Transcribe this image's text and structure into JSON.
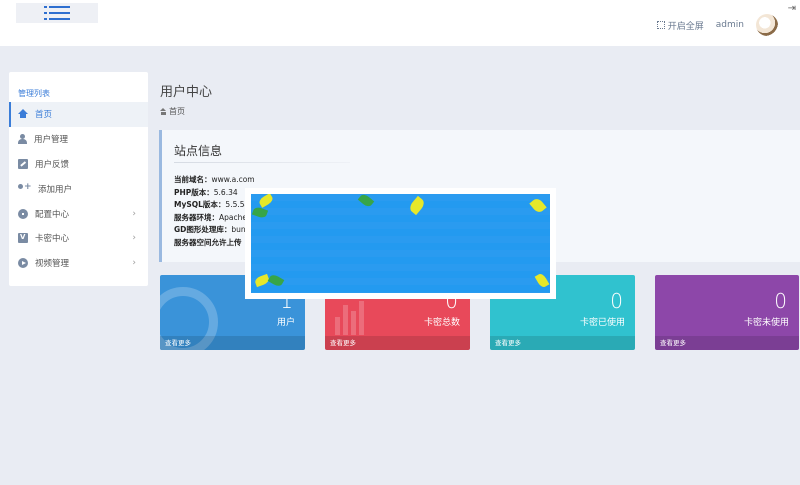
{
  "header": {
    "fullscreen_label": "开启全屏",
    "username": "admin"
  },
  "sidebar": {
    "title": "管理列表",
    "items": [
      {
        "label": "首页",
        "icon": "home-icon",
        "active": true,
        "expandable": false
      },
      {
        "label": "用户管理",
        "icon": "user-icon",
        "active": false,
        "expandable": false
      },
      {
        "label": "用户反馈",
        "icon": "edit-icon",
        "active": false,
        "expandable": false
      },
      {
        "label": "添加用户",
        "icon": "add-user-icon",
        "active": false,
        "expandable": false
      },
      {
        "label": "配置中心",
        "icon": "gear-icon",
        "active": false,
        "expandable": true
      },
      {
        "label": "卡密中心",
        "icon": "card-icon",
        "active": false,
        "expandable": true
      },
      {
        "label": "视频管理",
        "icon": "play-icon",
        "active": false,
        "expandable": true
      }
    ]
  },
  "page": {
    "title": "用户中心",
    "breadcrumb": "首页"
  },
  "site_info": {
    "title": "站点信息",
    "lines": [
      {
        "label": "当前域名：",
        "value": "www.a.com"
      },
      {
        "label": "PHP版本：",
        "value": "5.6.34"
      },
      {
        "label": "MySQL版本：",
        "value": "5.5.54-l"
      },
      {
        "label": "服务器环境：",
        "value": "Apache,"
      },
      {
        "label": "GD图形处理库：",
        "value": "bunc"
      },
      {
        "label": "服务器空间允许上传",
        "value": ""
      }
    ]
  },
  "cards": [
    {
      "value": "1",
      "label": "用户",
      "more": "查看更多",
      "color": "#3a93d9"
    },
    {
      "value": "0",
      "label": "卡密总数",
      "more": "查看更多",
      "color": "#e8495a"
    },
    {
      "value": "0",
      "label": "卡密已使用",
      "more": "查看更多",
      "color": "#30c2cf"
    },
    {
      "value": "0",
      "label": "卡密未使用",
      "more": "查看更多",
      "color": "#8d47a9"
    }
  ],
  "colors": {
    "accent": "#3b7dd8",
    "background": "#e9ecf3"
  }
}
